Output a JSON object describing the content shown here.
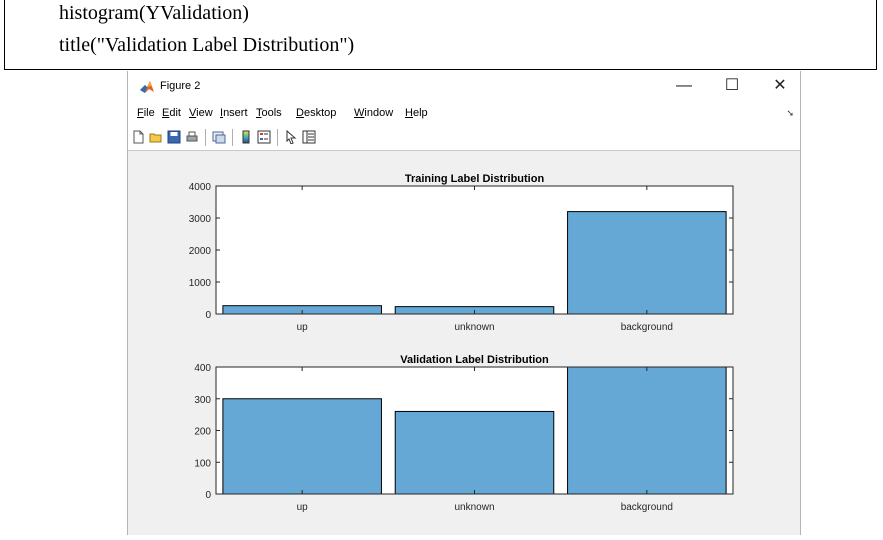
{
  "code": {
    "line1": "histogram(YValidation)",
    "line2": "title(\"Validation Label Distribution\")"
  },
  "window": {
    "title": "Figure 2",
    "minimize_symbol": "—",
    "maximize_symbol": "☐",
    "close_symbol": "✕"
  },
  "menu": {
    "items": [
      {
        "label": "File",
        "mnemonic": "F"
      },
      {
        "label": "Edit",
        "mnemonic": "E"
      },
      {
        "label": "View",
        "mnemonic": "V"
      },
      {
        "label": "Insert",
        "mnemonic": "I"
      },
      {
        "label": "Tools",
        "mnemonic": "T"
      },
      {
        "label": "Desktop",
        "mnemonic": "D"
      },
      {
        "label": "Window",
        "mnemonic": "W"
      },
      {
        "label": "Help",
        "mnemonic": "H"
      }
    ]
  },
  "toolbar": {
    "icons": [
      "new-figure-icon",
      "open-file-icon",
      "save-icon",
      "print-icon",
      "link-plot-icon",
      "colorbar-icon",
      "legend-icon",
      "pointer-icon",
      "property-inspector-icon"
    ]
  },
  "colors": {
    "bar_fill": "#65a8d6",
    "bar_edge": "#000000",
    "axes_bg": "#ffffff",
    "figure_bg": "#f0f0f0"
  },
  "chart_data": [
    {
      "type": "bar",
      "title": "Training Label Distribution",
      "categories": [
        "up",
        "unknown",
        "background"
      ],
      "values": [
        260,
        230,
        3200
      ],
      "ylim": [
        0,
        4000
      ],
      "yticks": [
        0,
        1000,
        2000,
        3000,
        4000
      ],
      "xlabel": "",
      "ylabel": ""
    },
    {
      "type": "bar",
      "title": "Validation Label Distribution",
      "categories": [
        "up",
        "unknown",
        "background"
      ],
      "values": [
        300,
        260,
        400
      ],
      "ylim": [
        0,
        400
      ],
      "yticks": [
        0,
        100,
        200,
        300,
        400
      ],
      "xlabel": "",
      "ylabel": ""
    }
  ]
}
